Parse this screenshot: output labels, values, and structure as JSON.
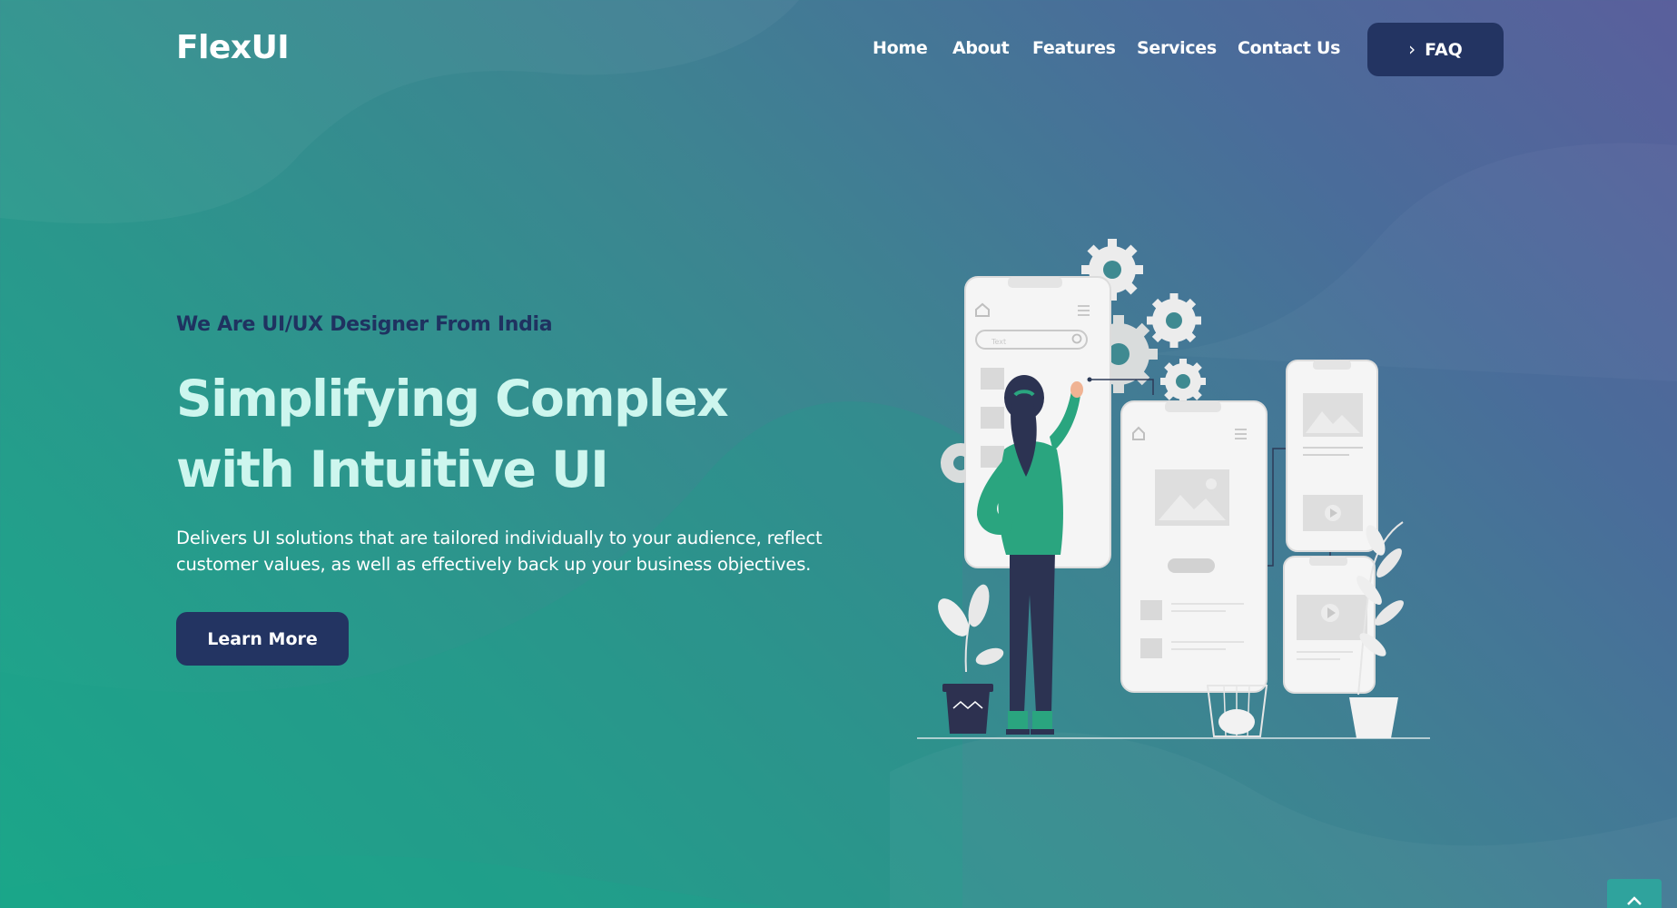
{
  "header": {
    "logo": "FlexUI",
    "nav": [
      {
        "label": "Home"
      },
      {
        "label": "About"
      },
      {
        "label": "Features"
      },
      {
        "label": "Services"
      },
      {
        "label": "Contact Us"
      }
    ],
    "faq_label": "FAQ"
  },
  "hero": {
    "tagline": "We Are UI/UX Designer From India",
    "headline_line1": "Simplifying Complex",
    "headline_line2": "with Intuitive UI",
    "description_line1": "Delivers UI solutions that are tailored individually to your audience, reflect",
    "description_line2": "customer values, as well as effectively back up your business objectives.",
    "cta_label": "Learn More"
  },
  "illustration": {
    "search_placeholder": "Text"
  },
  "colors": {
    "accent_dark": "#233462",
    "headline": "#cdf6ee",
    "tagline": "#1f3260",
    "figure_green": "#2aa57f"
  },
  "icons": {
    "faq": "chevron-right-icon",
    "scroll_top": "arrow-up-icon"
  }
}
